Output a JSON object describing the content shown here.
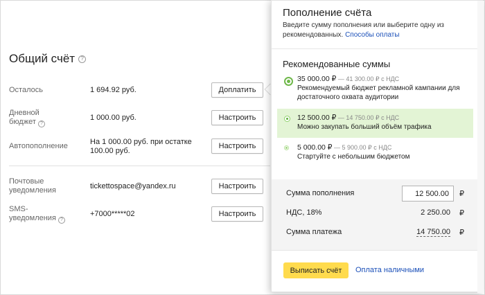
{
  "account": {
    "title": "Общий счёт",
    "rows": [
      {
        "label": "Осталось",
        "value": "1 694.92 руб.",
        "button": "Доплатить"
      },
      {
        "label_line1": "Дневной",
        "label_line2": "бюджет",
        "value": "1 000.00 руб.",
        "button": "Настроить"
      },
      {
        "label": "Автопополнение",
        "value_line1": "На 1 000.00 руб. при остатке",
        "value_line2": "100.00 руб.",
        "button": "Настроить"
      },
      {
        "label_line1": "Почтовые",
        "label_line2": "уведомления",
        "value": "tickettospace@yandex.ru",
        "button": "Настроить"
      },
      {
        "label_line1": "SMS-",
        "label_line2": "уведомления",
        "value": "+7000*****02",
        "button": "Настроить"
      }
    ]
  },
  "popup": {
    "title": "Пополнение счёта",
    "desc_line1": "Введите сумму пополнения или выберите одну из",
    "desc_line2_text": "рекомендованных. ",
    "desc_link": "Способы оплаты",
    "recommended_title": "Рекомендованные суммы",
    "options": [
      {
        "amount": "35 000.00 ₽",
        "vat": " — 41 300.00 ₽ с НДС",
        "desc_line1": "Рекомендуемый бюджет рекламной кампании для",
        "desc_line2": "достаточного охвата аудитории",
        "selected": false
      },
      {
        "amount": "12 500.00 ₽",
        "vat": " — 14 750.00 ₽ с НДС",
        "desc_line1": "Можно закупать больший объём трафика",
        "selected": true
      },
      {
        "amount": "5 000.00 ₽",
        "vat": " — 5 900.00 ₽ с НДС",
        "desc_line1": "Стартуйте с небольшим бюджетом",
        "selected": false
      }
    ],
    "calc": {
      "sum_label": "Сумма пополнения",
      "sum_value": "12 500.00",
      "vat_label": "НДС, 18%",
      "vat_value": "2 250.00",
      "total_label": "Сумма платежа",
      "total_value": "14 750.00",
      "currency": "₽"
    },
    "invoice_button": "Выписать счёт",
    "cash_link": "Оплата наличными"
  },
  "colors": {
    "accent_yellow": "#ffdb4d",
    "link_blue": "#1a4fb8",
    "selected_bg": "#e3f4d5",
    "radio_green": "#6fb84a"
  },
  "icons": {
    "help": "question-circle-icon"
  }
}
